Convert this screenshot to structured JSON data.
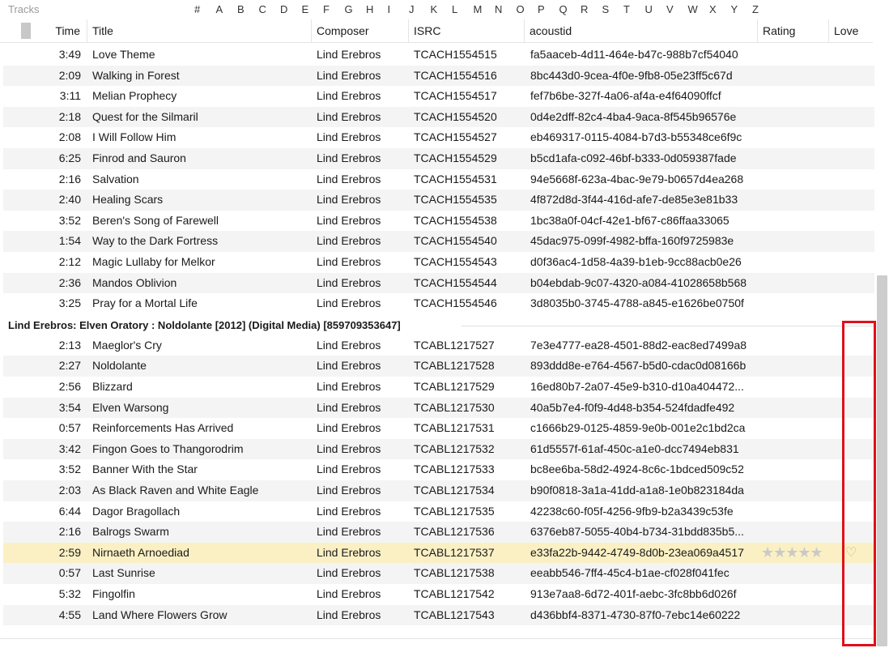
{
  "panel_title": "Tracks",
  "alphabet": [
    "#",
    "A",
    "B",
    "C",
    "D",
    "E",
    "F",
    "G",
    "H",
    "I",
    "J",
    "K",
    "L",
    "M",
    "N",
    "O",
    "P",
    "Q",
    "R",
    "S",
    "T",
    "U",
    "V",
    "W",
    "X",
    "Y",
    "Z"
  ],
  "columns": {
    "time": "Time",
    "title": "Title",
    "composer": "Composer",
    "isrc": "ISRC",
    "acoustid": "acoustid",
    "rating": "Rating",
    "love": "Love"
  },
  "tracks_a": [
    {
      "time": "3:49",
      "title": "Love Theme",
      "composer": "Lind Erebros",
      "isrc": "TCACH1554515",
      "acoustid": "fa5aaceb-4d11-464e-b47c-988b7cf54040"
    },
    {
      "time": "2:09",
      "title": "Walking in Forest",
      "composer": "Lind Erebros",
      "isrc": "TCACH1554516",
      "acoustid": "8bc443d0-9cea-4f0e-9fb8-05e23ff5c67d"
    },
    {
      "time": "3:11",
      "title": "Melian Prophecy",
      "composer": "Lind Erebros",
      "isrc": "TCACH1554517",
      "acoustid": "fef7b6be-327f-4a06-af4a-e4f64090ffcf"
    },
    {
      "time": "2:18",
      "title": "Quest for the Silmaril",
      "composer": "Lind Erebros",
      "isrc": "TCACH1554520",
      "acoustid": "0d4e2dff-82c4-4ba4-9aca-8f545b96576e"
    },
    {
      "time": "2:08",
      "title": "I Will Follow Him",
      "composer": "Lind Erebros",
      "isrc": "TCACH1554527",
      "acoustid": "eb469317-0115-4084-b7d3-b55348ce6f9c"
    },
    {
      "time": "6:25",
      "title": "Finrod and Sauron",
      "composer": "Lind Erebros",
      "isrc": "TCACH1554529",
      "acoustid": "b5cd1afa-c092-46bf-b333-0d059387fade"
    },
    {
      "time": "2:16",
      "title": "Salvation",
      "composer": "Lind Erebros",
      "isrc": "TCACH1554531",
      "acoustid": "94e5668f-623a-4bac-9e79-b0657d4ea268"
    },
    {
      "time": "2:40",
      "title": "Healing Scars",
      "composer": "Lind Erebros",
      "isrc": "TCACH1554535",
      "acoustid": "4f872d8d-3f44-416d-afe7-de85e3e81b33"
    },
    {
      "time": "3:52",
      "title": "Beren's Song of Farewell",
      "composer": "Lind Erebros",
      "isrc": "TCACH1554538",
      "acoustid": "1bc38a0f-04cf-42e1-bf67-c86ffaa33065"
    },
    {
      "time": "1:54",
      "title": "Way to the Dark Fortress",
      "composer": "Lind Erebros",
      "isrc": "TCACH1554540",
      "acoustid": "45dac975-099f-4982-bffa-160f9725983e"
    },
    {
      "time": "2:12",
      "title": "Magic Lullaby for Melkor",
      "composer": "Lind Erebros",
      "isrc": "TCACH1554543",
      "acoustid": "d0f36ac4-1d58-4a39-b1eb-9cc88acb0e26"
    },
    {
      "time": "2:36",
      "title": "Mandos Oblivion",
      "composer": "Lind Erebros",
      "isrc": "TCACH1554544",
      "acoustid": "b04ebdab-9c07-4320-a084-41028658b568"
    },
    {
      "time": "3:25",
      "title": "Pray for a Mortal Life",
      "composer": "Lind Erebros",
      "isrc": "TCACH1554546",
      "acoustid": "3d8035b0-3745-4788-a845-e1626be0750f"
    }
  ],
  "group_header": "Lind Erebros: Elven Oratory : Noldolante [2012] (Digital Media) [859709353647]",
  "tracks_b": [
    {
      "time": "2:13",
      "title": "Maeglor's Cry",
      "composer": "Lind Erebros",
      "isrc": "TCABL1217527",
      "acoustid": "7e3e4777-ea28-4501-88d2-eac8ed7499a8"
    },
    {
      "time": "2:27",
      "title": "Noldolante",
      "composer": "Lind Erebros",
      "isrc": "TCABL1217528",
      "acoustid": "893ddd8e-e764-4567-b5d0-cdac0d08166b"
    },
    {
      "time": "2:56",
      "title": "Blizzard",
      "composer": "Lind Erebros",
      "isrc": "TCABL1217529",
      "acoustid": "16ed80b7-2a07-45e9-b310-d10a404472..."
    },
    {
      "time": "3:54",
      "title": "Elven Warsong",
      "composer": "Lind Erebros",
      "isrc": "TCABL1217530",
      "acoustid": "40a5b7e4-f0f9-4d48-b354-524fdadfe492"
    },
    {
      "time": "0:57",
      "title": "Reinforcements Has Arrived",
      "composer": "Lind Erebros",
      "isrc": "TCABL1217531",
      "acoustid": "c1666b29-0125-4859-9e0b-001e2c1bd2ca"
    },
    {
      "time": "3:42",
      "title": "Fingon Goes to Thangorodrim",
      "composer": "Lind Erebros",
      "isrc": "TCABL1217532",
      "acoustid": "61d5557f-61af-450c-a1e0-dcc7494eb831"
    },
    {
      "time": "3:52",
      "title": "Banner With the Star",
      "composer": "Lind Erebros",
      "isrc": "TCABL1217533",
      "acoustid": "bc8ee6ba-58d2-4924-8c6c-1bdced509c52"
    },
    {
      "time": "2:03",
      "title": "As Black Raven and White Eagle",
      "composer": "Lind Erebros",
      "isrc": "TCABL1217534",
      "acoustid": "b90f0818-3a1a-41dd-a1a8-1e0b823184da"
    },
    {
      "time": "6:44",
      "title": "Dagor Bragollach",
      "composer": "Lind Erebros",
      "isrc": "TCABL1217535",
      "acoustid": "42238c60-f05f-4256-9fb9-b2a3439c53fe"
    },
    {
      "time": "2:16",
      "title": "Balrogs Swarm",
      "composer": "Lind Erebros",
      "isrc": "TCABL1217536",
      "acoustid": "6376eb87-5055-40b4-b734-31bdd835b5..."
    },
    {
      "time": "2:59",
      "title": "Nirnaeth Arnoediad",
      "composer": "Lind Erebros",
      "isrc": "TCABL1217537",
      "acoustid": "e33fa22b-9442-4749-8d0b-23ea069a4517",
      "selected": true,
      "rating_stars": "★★★★★",
      "love_icon": "♡"
    },
    {
      "time": "0:57",
      "title": "Last Sunrise",
      "composer": "Lind Erebros",
      "isrc": "TCABL1217538",
      "acoustid": "eeabb546-7ff4-45c4-b1ae-cf028f041fec"
    },
    {
      "time": "5:32",
      "title": "Fingolfin",
      "composer": "Lind Erebros",
      "isrc": "TCABL1217542",
      "acoustid": "913e7aa8-6d72-401f-aebc-3fc8bb6d026f"
    },
    {
      "time": "4:55",
      "title": "Land Where Flowers Grow",
      "composer": "Lind Erebros",
      "isrc": "TCABL1217543",
      "acoustid": "d436bbf4-8371-4730-87f0-7ebc14e60222"
    }
  ],
  "colors": {
    "selected_row": "#faf0c4",
    "alt_row": "#f4f4f4",
    "highlight_box": "#e0101a"
  }
}
